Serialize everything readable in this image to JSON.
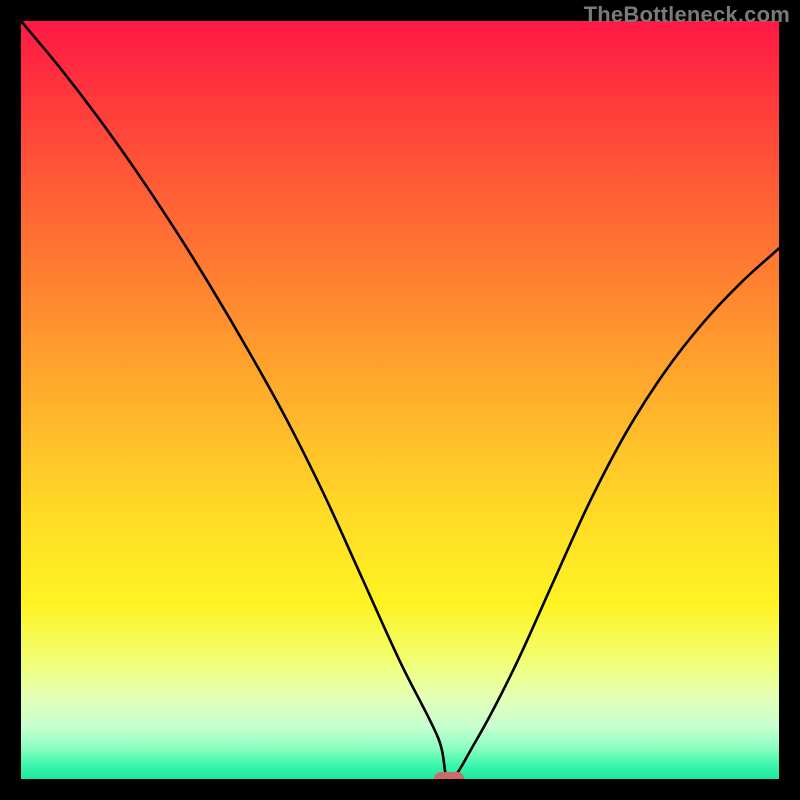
{
  "watermark": "TheBottleneck.com",
  "chart_data": {
    "type": "line",
    "title": "",
    "xlabel": "",
    "ylabel": "",
    "xlim": [
      0,
      100
    ],
    "ylim": [
      0,
      100
    ],
    "grid": false,
    "legend": false,
    "background_gradient": {
      "top_color": "#ff1846",
      "bottom_color": "#1ae79d",
      "description": "vertical rainbow gradient (red → orange → yellow → green)"
    },
    "series": [
      {
        "name": "bottleneck-curve",
        "color": "#000000",
        "x": [
          0,
          5,
          10,
          15,
          20,
          25,
          30,
          35,
          40,
          45,
          50,
          55,
          56.5,
          60,
          65,
          70,
          75,
          80,
          85,
          90,
          95,
          100
        ],
        "values": [
          100,
          94,
          87.5,
          80.5,
          73,
          65,
          56.5,
          47.5,
          37.5,
          26.5,
          15.5,
          5.5,
          0,
          5,
          14.5,
          25.5,
          36.5,
          46,
          53.8,
          60.2,
          65.5,
          70
        ]
      }
    ],
    "annotations": [
      {
        "name": "minimum-marker",
        "shape": "rounded-rect",
        "color": "#cc6b6b",
        "x": 56.5,
        "y": 0
      }
    ]
  }
}
